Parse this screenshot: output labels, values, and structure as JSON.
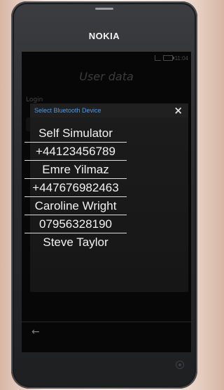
{
  "device": {
    "brand": "NOKIA"
  },
  "status_bar": {
    "time": "11:04"
  },
  "app": {
    "page_title": "User data",
    "login_label": "Login"
  },
  "dialog": {
    "title": "Select Bluetooth Device",
    "close_icon": "×",
    "items": [
      "Self Simulator",
      "+44123456789",
      "Emre Yilmaz",
      "+447676982463",
      "Caroline Wright",
      "07956328190",
      "Steve Taylor"
    ]
  },
  "toolbar": {
    "back_icon": "←"
  }
}
